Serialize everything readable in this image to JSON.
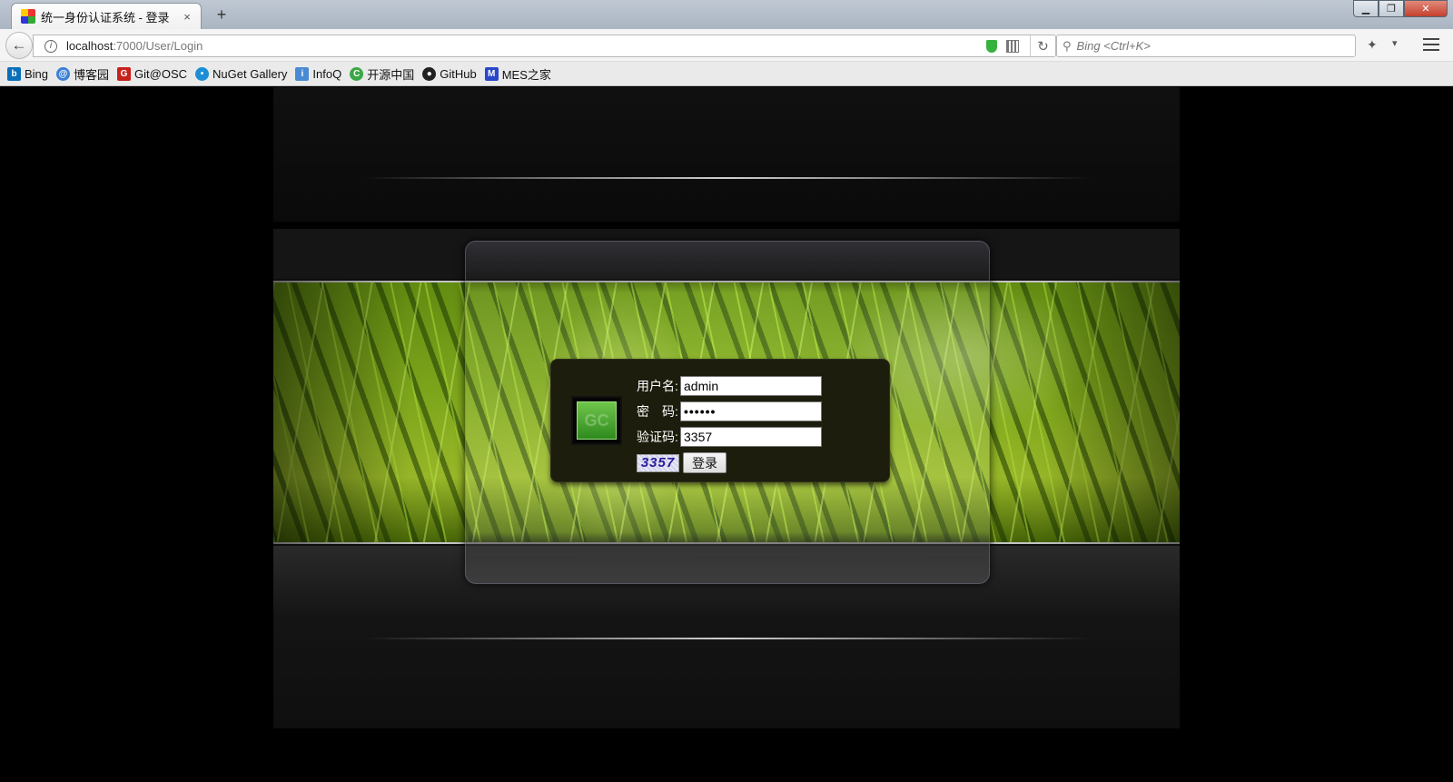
{
  "browser": {
    "tab_title": "统一身份认证系统 - 登录",
    "tab_close": "×",
    "new_tab": "+",
    "window_controls": {
      "minimize": "▁",
      "restore": "❐",
      "close": "✕"
    },
    "url_host": "localhost",
    "url_path": ":7000/User/Login",
    "search_placeholder": "Bing <Ctrl+K>",
    "icons": [
      "back-arrow-icon",
      "info-icon",
      "shield-icon",
      "qr-code-icon",
      "reload-icon",
      "search-icon",
      "bird-icon",
      "dropdown-icon",
      "menu-icon"
    ]
  },
  "bookmarks": [
    {
      "label": "Bing",
      "icon": "bing-icon",
      "color": "#0a6fb8",
      "glyph": "b"
    },
    {
      "label": "博客园",
      "icon": "cnblogs-icon",
      "color": "#3b7fd6",
      "glyph": "@"
    },
    {
      "label": "Git@OSC",
      "icon": "gitosc-icon",
      "color": "#c7211c",
      "glyph": "G"
    },
    {
      "label": "NuGet Gallery",
      "icon": "nuget-icon",
      "color": "#1c8fd6",
      "glyph": "•"
    },
    {
      "label": "InfoQ",
      "icon": "infoq-icon",
      "color": "#4a8ad4",
      "glyph": "i"
    },
    {
      "label": "开源中国",
      "icon": "oschina-icon",
      "color": "#3aa845",
      "glyph": "C"
    },
    {
      "label": "GitHub",
      "icon": "github-icon",
      "color": "#222222",
      "glyph": "●"
    },
    {
      "label": "MES之家",
      "icon": "mes-icon",
      "color": "#2a46c9",
      "glyph": "M"
    }
  ],
  "login": {
    "username_label": "用户名:",
    "username_value": "admin",
    "password_label": "密　码:",
    "password_value": "••••••",
    "captcha_label": "验证码:",
    "captcha_value": "3357",
    "captcha_image_text": "3357",
    "submit_label": "登录",
    "logo_text": "GC"
  }
}
